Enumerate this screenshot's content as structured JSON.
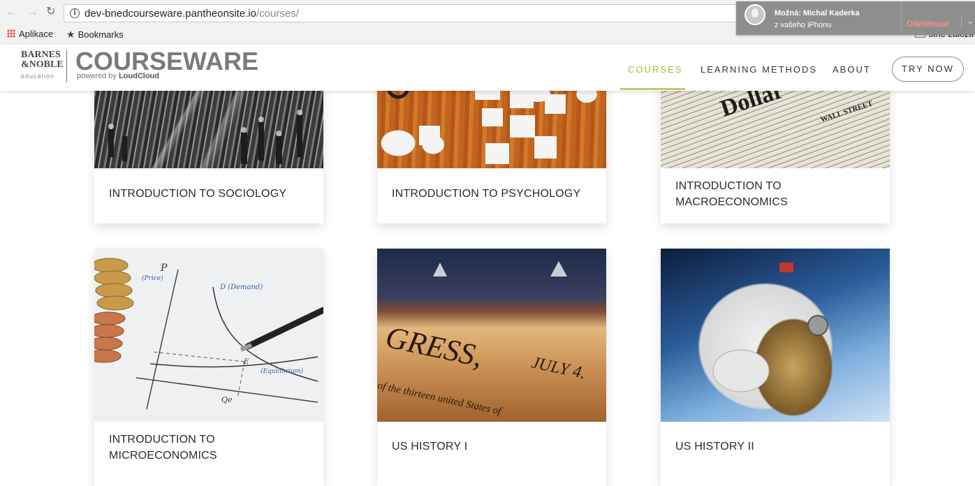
{
  "browser": {
    "url_host": "dev-bnedcourseware.pantheonsite.io",
    "url_path": "/courses/",
    "bookmarks": [
      {
        "label": "Aplikace",
        "icon": "apps-grid-icon"
      },
      {
        "label": "Bookmarks",
        "icon": "star-icon"
      }
    ],
    "other_bookmarks": "Jiné záložk",
    "notification": {
      "title": "Možná: Michal Kaderka",
      "subtitle": "z vašeho iPhonu",
      "action": "Odmítnout"
    }
  },
  "header": {
    "brand_lines": [
      "BARNES",
      "&NOBLE",
      "education"
    ],
    "product": "COURSEWARE",
    "powered_prefix": "powered by ",
    "powered_brand": "LoudCloud",
    "nav": [
      "COURSES",
      "LEARNING METHODS",
      "ABOUT"
    ],
    "active_nav": "COURSES",
    "accent_color": "#b2b234",
    "cta": "TRY NOW"
  },
  "courses": [
    {
      "title": "INTRODUCTION TO SOCIOLOGY"
    },
    {
      "title": "INTRODUCTION TO PSYCHOLOGY"
    },
    {
      "title": "INTRODUCTION TO MACROECONOMICS"
    },
    {
      "title": "INTRODUCTION TO MICROECONOMICS"
    },
    {
      "title": "US HISTORY I"
    },
    {
      "title": "US HISTORY II"
    }
  ],
  "image_text": {
    "macro_headline": "Dollar",
    "macro_wall_street": "WALL STREET",
    "micro_p": "P",
    "micro_price": "(Price)",
    "micro_demand": "D (Demand)",
    "micro_equilibrium": "(Equilibrium)",
    "micro_e": "E",
    "micro_qe": "Qe",
    "history_line1": "GRESS,",
    "history_line2": "JULY 4.",
    "history_line3": "of the thirteen united States of"
  }
}
